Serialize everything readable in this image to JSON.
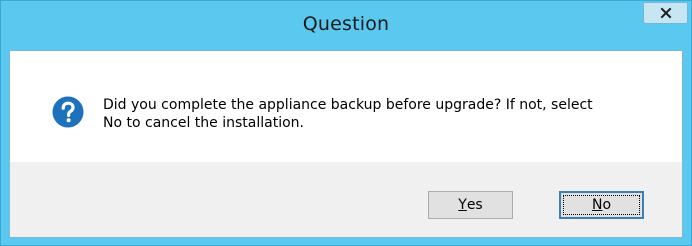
{
  "window": {
    "title": "Question",
    "close_glyph": "x"
  },
  "dialog": {
    "icon": "question-icon",
    "message_line1": "Did you complete the appliance backup before upgrade?  If not, select",
    "message_line2": "No to cancel the installation."
  },
  "buttons": {
    "yes": {
      "mnemonic": "Y",
      "rest": "es"
    },
    "no": {
      "mnemonic": "N",
      "rest": "o"
    }
  },
  "colors": {
    "titlebar": "#5bc8f0",
    "icon": "#1e72bd",
    "footer": "#f0f0f0"
  }
}
